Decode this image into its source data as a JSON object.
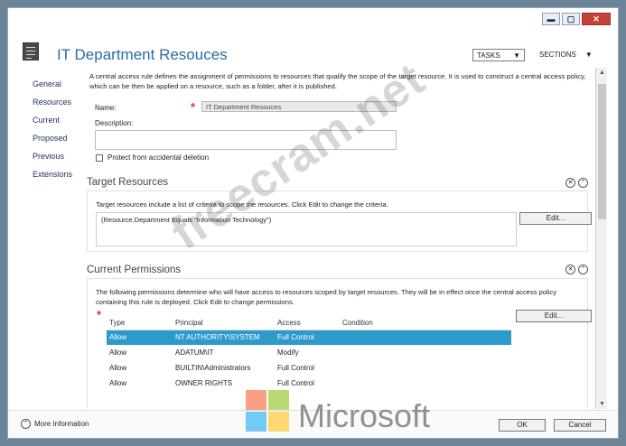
{
  "window": {
    "controls": {
      "minimize": "▬",
      "maximize": "▢",
      "close": "✕"
    }
  },
  "header": {
    "title": "IT Department Resouces",
    "tasks": "TASKS",
    "sections": "SECTIONS"
  },
  "nav": {
    "items": [
      "General",
      "Resources",
      "Current",
      "Proposed",
      "Previous",
      "Extensions"
    ]
  },
  "general": {
    "intro": "A central access rule defines the assignment of permissions to resources that qualify the scope of the target resource. It is used to construct a central access policy, which can be then be applied on a resource, such as a folder, after it is published.",
    "name_label": "Name:",
    "name_value": "IT Department Resouces",
    "description_label": "Description:",
    "protect_label": "Protect from accidental deletion"
  },
  "target_resources": {
    "heading": "Target Resources",
    "description": "Target resources include a list of criteria to scope the resources. Click Edit to change the criteria.",
    "criteria": "(Resource.Department Equals \"Information Technology\")",
    "edit_label": "Edit..."
  },
  "current_permissions": {
    "heading": "Current Permissions",
    "description": "The following permissions determine who will have access to resources scoped by target resources. They will be in effect once the central access policy containing this rule is deployed. Click Edit to change permissions.",
    "edit_label": "Edit...",
    "columns": [
      "Type",
      "Principal",
      "Access",
      "Condition"
    ],
    "rows": [
      {
        "type": "Allow",
        "principal": "NT AUTHORITY\\SYSTEM",
        "access": "Full Control",
        "condition": ""
      },
      {
        "type": "Allow",
        "principal": "ADATUM\\IT",
        "access": "Modify",
        "condition": ""
      },
      {
        "type": "Allow",
        "principal": "BUILTIN\\Administrators",
        "access": "Full Control",
        "condition": ""
      },
      {
        "type": "Allow",
        "principal": "OWNER RIGHTS",
        "access": "Full Control",
        "condition": ""
      }
    ]
  },
  "footer": {
    "more_info": "More Information",
    "ok": "OK",
    "cancel": "Cancel"
  },
  "watermarks": {
    "site": "freecram.net",
    "brand": "Microsoft"
  },
  "colors": {
    "accent": "#2c6aa8",
    "selection": "#2e9acb",
    "required": "#d43a2f",
    "close_button": "#c7413b",
    "ms_red": "#f25022",
    "ms_green": "#7fba00",
    "ms_blue": "#00a4ef",
    "ms_yellow": "#ffb900"
  }
}
